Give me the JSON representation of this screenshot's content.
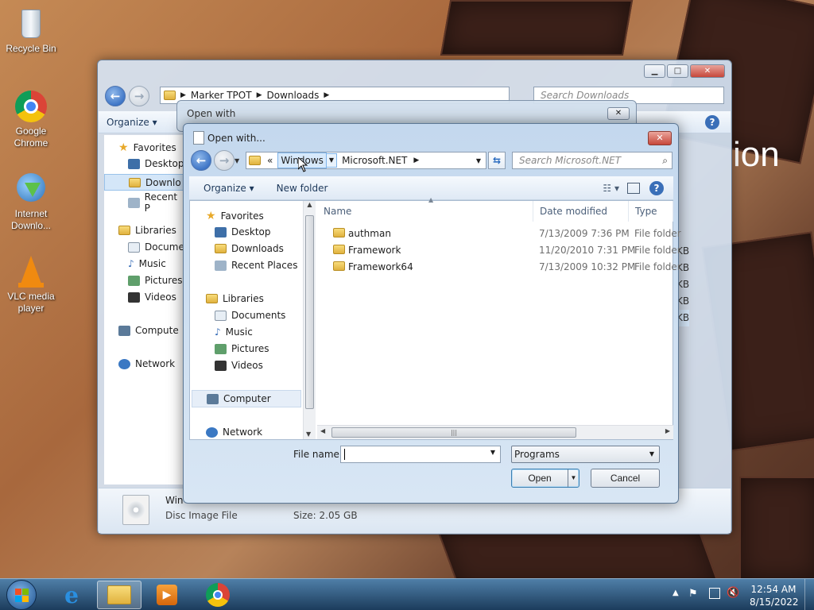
{
  "desktop": {
    "icons": [
      {
        "label": "Recycle Bin"
      },
      {
        "label": "Google Chrome"
      },
      {
        "label": "Internet Downlo..."
      },
      {
        "label": "VLC media player"
      }
    ],
    "bg_text": "ion"
  },
  "explorer": {
    "breadcrumb": [
      "Marker TPOT",
      "Downloads"
    ],
    "search_placeholder": "Search Downloads",
    "organize": "Organize",
    "nav": [
      "Favorites",
      "Desktop",
      "Downlo",
      "Recent P",
      "Libraries",
      "Docume",
      "Music",
      "Pictures",
      "Videos",
      "Compute",
      "Network"
    ],
    "sizes": [
      "KB",
      "KB",
      "KB",
      "KB",
      "KB"
    ],
    "status": {
      "name": "Win",
      "type": "Disc Image File",
      "size": "Size: 2.05 GB"
    }
  },
  "openwith_outer": {
    "title": "Open with"
  },
  "dialog": {
    "title": "Open with...",
    "breadcrumb": {
      "prefix": "«",
      "items": [
        "Windows",
        "Microsoft.NET"
      ]
    },
    "search_placeholder": "Search Microsoft.NET",
    "toolbar": {
      "organize": "Organize",
      "new_folder": "New folder"
    },
    "nav": [
      {
        "label": "Favorites",
        "icon": "star-icon"
      },
      {
        "label": "Desktop",
        "icon": "desktop-icon"
      },
      {
        "label": "Downloads",
        "icon": "downloads-icon"
      },
      {
        "label": "Recent Places",
        "icon": "recent-places-icon"
      },
      {
        "label": "Libraries",
        "icon": "libraries-icon"
      },
      {
        "label": "Documents",
        "icon": "documents-icon"
      },
      {
        "label": "Music",
        "icon": "music-icon"
      },
      {
        "label": "Pictures",
        "icon": "pictures-icon"
      },
      {
        "label": "Videos",
        "icon": "videos-icon"
      },
      {
        "label": "Computer",
        "icon": "computer-icon"
      },
      {
        "label": "Network",
        "icon": "network-icon"
      }
    ],
    "columns": {
      "name": "Name",
      "date": "Date modified",
      "type": "Type"
    },
    "files": [
      {
        "name": "authman",
        "date": "7/13/2009 7:36 PM",
        "type": "File folder"
      },
      {
        "name": "Framework",
        "date": "11/20/2010 7:31 PM",
        "type": "File folder"
      },
      {
        "name": "Framework64",
        "date": "7/13/2009 10:32 PM",
        "type": "File folder"
      }
    ],
    "filename_label": "File name:",
    "filename_value": "",
    "filter_value": "Programs",
    "open_label": "Open",
    "cancel_label": "Cancel"
  },
  "taskbar": {
    "time": "12:54 AM",
    "date": "8/15/2022"
  }
}
